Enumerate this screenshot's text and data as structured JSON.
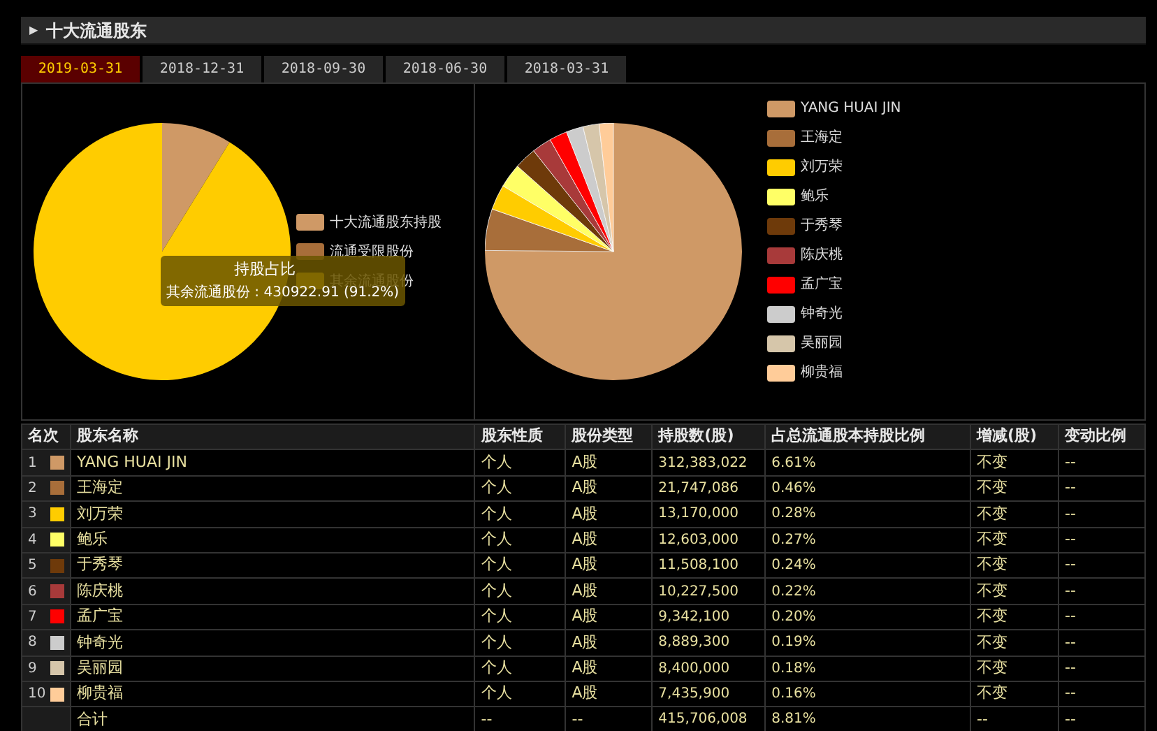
{
  "header": {
    "icon": "▶",
    "title": "十大流通股东"
  },
  "tabs": [
    {
      "label": "2019-03-31",
      "selected": true
    },
    {
      "label": "2018-12-31",
      "selected": false
    },
    {
      "label": "2018-09-30",
      "selected": false
    },
    {
      "label": "2018-06-30",
      "selected": false
    },
    {
      "label": "2018-03-31",
      "selected": false
    }
  ],
  "left_chart": {
    "tooltip": {
      "title": "持股占比",
      "line": "其余流通股份 : 430922.91 (91.2%)"
    },
    "chart_data": {
      "type": "pie",
      "categories": [
        "十大流通股东持股",
        "流通受限股份",
        "其余流通股份"
      ],
      "series": [
        {
          "values": [
            8.8,
            0,
            91.2
          ]
        }
      ],
      "colors": [
        "#cf9966",
        "#a86e3a",
        "#ffcc00"
      ]
    }
  },
  "right_chart": {
    "chart_data": {
      "type": "pie",
      "categories": [
        "YANG HUAI JIN",
        "王海定",
        "刘万荣",
        "鲍乐",
        "于秀琴",
        "陈庆桃",
        "孟广宝",
        "钟奇光",
        "吴丽园",
        "柳贵福"
      ],
      "series": [
        {
          "values": [
            75.14,
            5.23,
            3.17,
            3.03,
            2.77,
            2.46,
            2.25,
            2.14,
            2.02,
            1.79
          ]
        }
      ],
      "colors": [
        "#cf9966",
        "#a86e3a",
        "#ffcc00",
        "#ffff66",
        "#6e3a0a",
        "#a83a3a",
        "#ff0000",
        "#cccccc",
        "#d6c6aa",
        "#ffcc99"
      ]
    }
  },
  "table": {
    "columns": [
      "名次",
      "股东名称",
      "股东性质",
      "股份类型",
      "持股数(股)",
      "占总流通股本持股比例",
      "增减(股)",
      "变动比例"
    ],
    "rows": [
      {
        "rank": "1",
        "color": "#cf9966",
        "name": "YANG HUAI JIN",
        "nature": "个人",
        "type": "A股",
        "shares": "312,383,022",
        "ratio": "6.61%",
        "change": "不变",
        "change_ratio": "--"
      },
      {
        "rank": "2",
        "color": "#a86e3a",
        "name": "王海定",
        "nature": "个人",
        "type": "A股",
        "shares": "21,747,086",
        "ratio": "0.46%",
        "change": "不变",
        "change_ratio": "--"
      },
      {
        "rank": "3",
        "color": "#ffcc00",
        "name": "刘万荣",
        "nature": "个人",
        "type": "A股",
        "shares": "13,170,000",
        "ratio": "0.28%",
        "change": "不变",
        "change_ratio": "--"
      },
      {
        "rank": "4",
        "color": "#ffff66",
        "name": "鲍乐",
        "nature": "个人",
        "type": "A股",
        "shares": "12,603,000",
        "ratio": "0.27%",
        "change": "不变",
        "change_ratio": "--"
      },
      {
        "rank": "5",
        "color": "#6e3a0a",
        "name": "于秀琴",
        "nature": "个人",
        "type": "A股",
        "shares": "11,508,100",
        "ratio": "0.24%",
        "change": "不变",
        "change_ratio": "--"
      },
      {
        "rank": "6",
        "color": "#a83a3a",
        "name": "陈庆桃",
        "nature": "个人",
        "type": "A股",
        "shares": "10,227,500",
        "ratio": "0.22%",
        "change": "不变",
        "change_ratio": "--"
      },
      {
        "rank": "7",
        "color": "#ff0000",
        "name": "孟广宝",
        "nature": "个人",
        "type": "A股",
        "shares": "9,342,100",
        "ratio": "0.20%",
        "change": "不变",
        "change_ratio": "--"
      },
      {
        "rank": "8",
        "color": "#cccccc",
        "name": "钟奇光",
        "nature": "个人",
        "type": "A股",
        "shares": "8,889,300",
        "ratio": "0.19%",
        "change": "不变",
        "change_ratio": "--"
      },
      {
        "rank": "9",
        "color": "#d6c6aa",
        "name": "吴丽园",
        "nature": "个人",
        "type": "A股",
        "shares": "8,400,000",
        "ratio": "0.18%",
        "change": "不变",
        "change_ratio": "--"
      },
      {
        "rank": "10",
        "color": "#ffcc99",
        "name": "柳贵福",
        "nature": "个人",
        "type": "A股",
        "shares": "7,435,900",
        "ratio": "0.16%",
        "change": "不变",
        "change_ratio": "--"
      }
    ],
    "total": {
      "name": "合计",
      "nature": "--",
      "type": "--",
      "shares": "415,706,008",
      "ratio": "8.81%",
      "change": "--",
      "change_ratio": "--"
    }
  }
}
